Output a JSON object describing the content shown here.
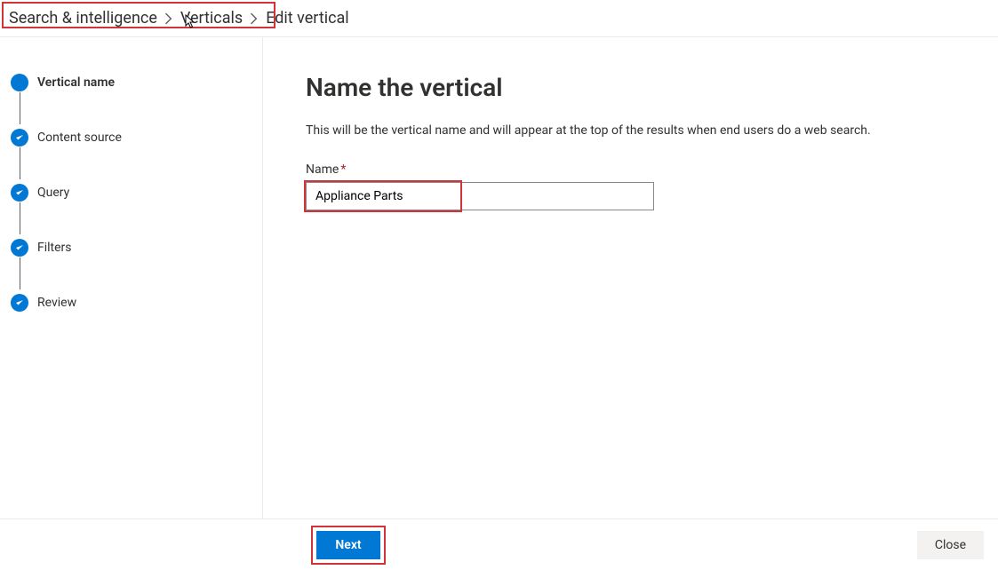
{
  "breadcrumb": {
    "items": [
      {
        "label": "Search & intelligence"
      },
      {
        "label": "Verticals"
      }
    ],
    "current": "Edit vertical"
  },
  "sidebar": {
    "steps": [
      {
        "label": "Vertical name",
        "state": "current"
      },
      {
        "label": "Content source",
        "state": "completed"
      },
      {
        "label": "Query",
        "state": "completed"
      },
      {
        "label": "Filters",
        "state": "completed"
      },
      {
        "label": "Review",
        "state": "completed"
      }
    ]
  },
  "content": {
    "title": "Name the vertical",
    "description": "This will be the vertical name and will appear at the top of the results when end users do a web search.",
    "nameField": {
      "label": "Name",
      "requiredMark": "*",
      "value": "Appliance Parts"
    }
  },
  "footer": {
    "primaryLabel": "Next",
    "closeLabel": "Close"
  },
  "colors": {
    "accent": "#0078d4",
    "highlight": "#d13438",
    "border": "#edebe9",
    "text": "#323130"
  }
}
